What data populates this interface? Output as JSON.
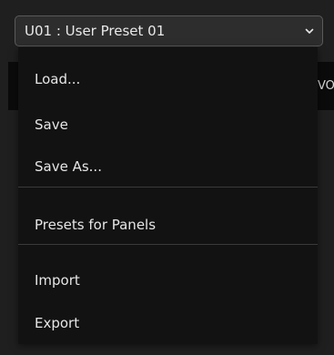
{
  "preset_select": {
    "value": "U01 : User Preset 01",
    "icon": "chevron-down-icon"
  },
  "background": {
    "partial_text": "VO"
  },
  "menu": {
    "items": [
      {
        "label": "Load..."
      },
      {
        "label": "Save"
      },
      {
        "label": "Save As..."
      },
      {
        "label": "Presets for Panels"
      },
      {
        "label": "Import"
      },
      {
        "label": "Export"
      }
    ]
  },
  "colors": {
    "page_background": "#1f1f1f",
    "menu_background": "#121212",
    "select_border": "#5a5a5a",
    "text": "#e6e6e6"
  }
}
